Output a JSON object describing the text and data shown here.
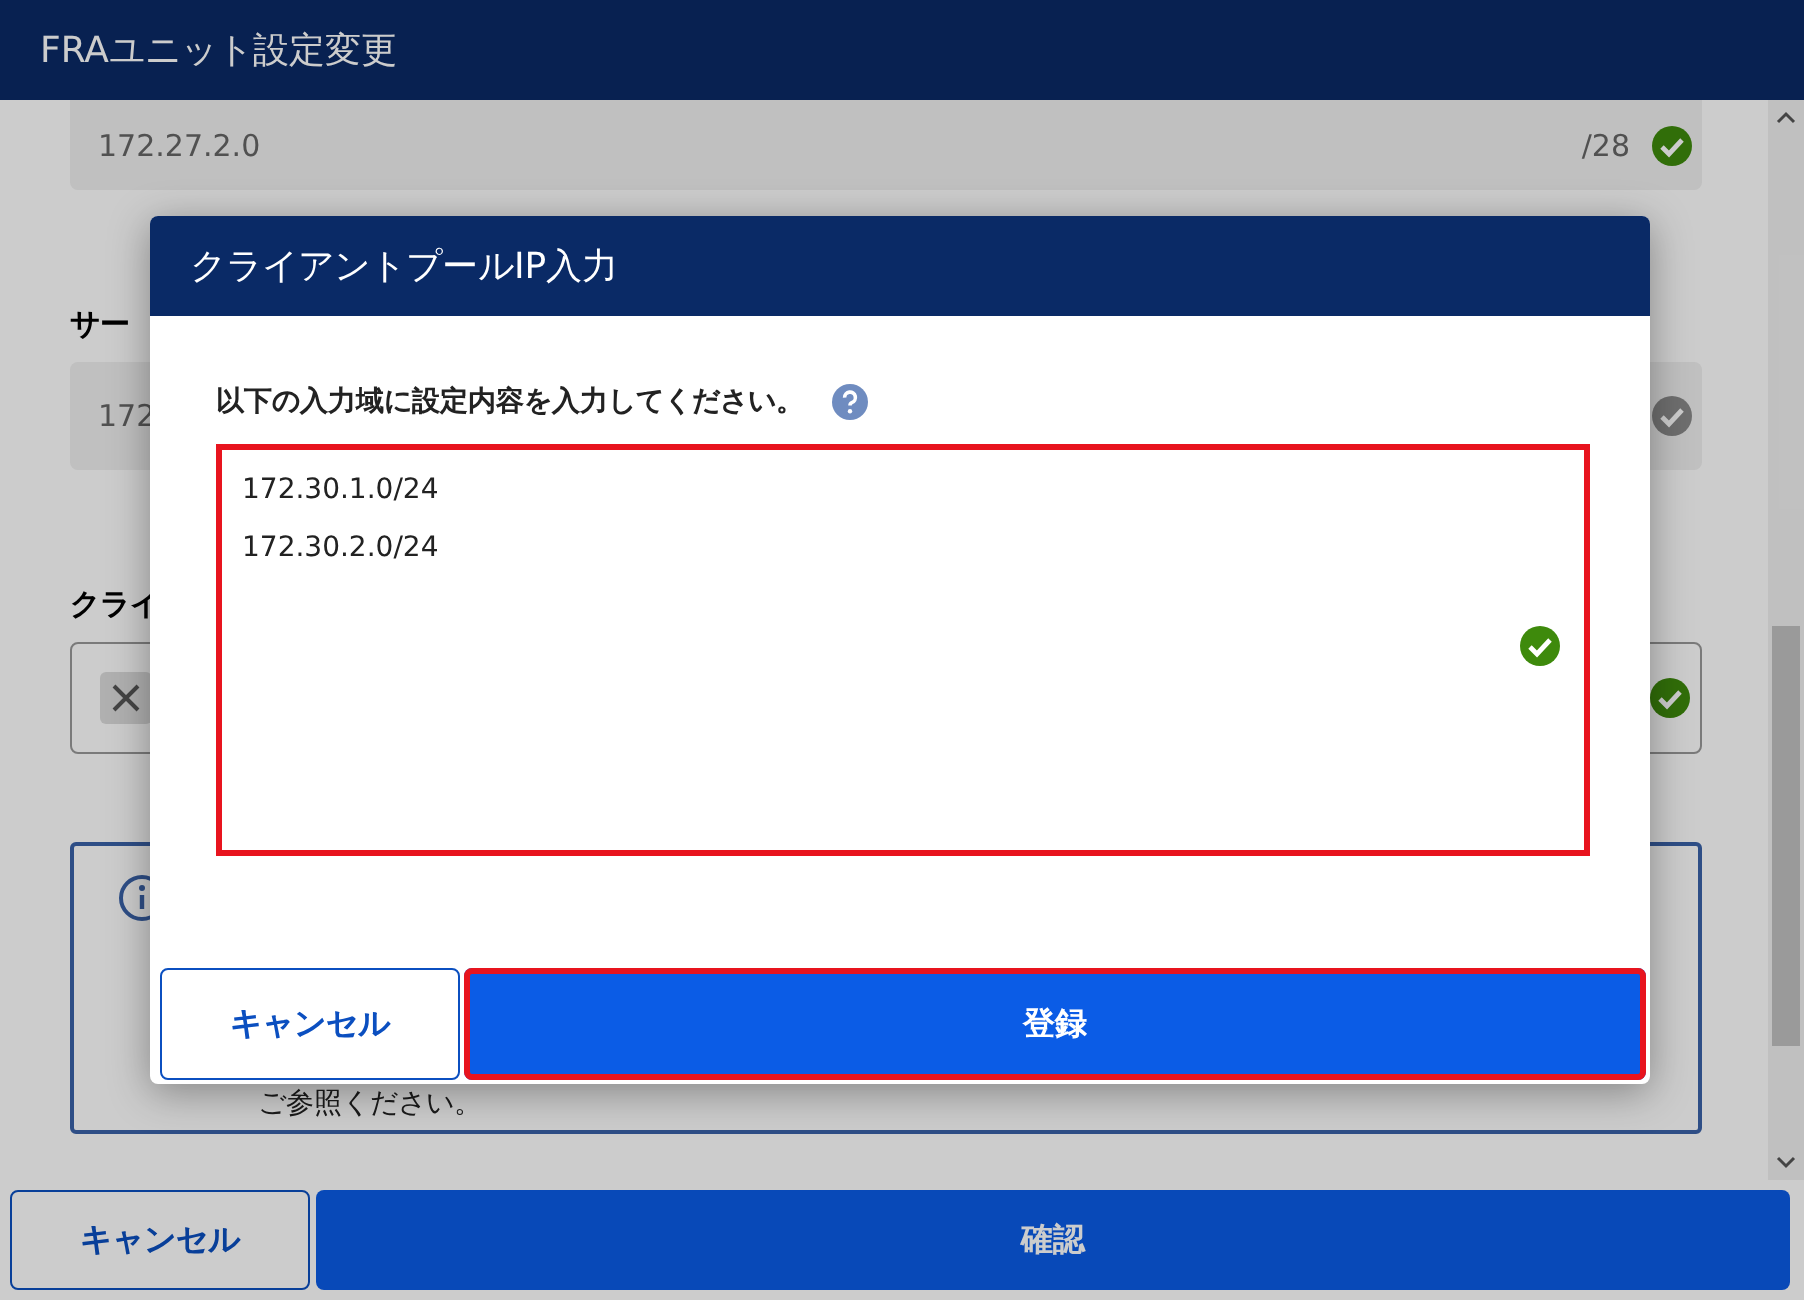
{
  "window": {
    "title": "FRAユニット設定変更"
  },
  "fields": [
    {
      "kind": "prefix",
      "value": "172.27.2.0",
      "suffix": "/28",
      "valid": true
    },
    {
      "kind": "text",
      "label": "サー",
      "value": "172",
      "valid": false
    },
    {
      "kind": "chips",
      "label": "クライ",
      "valid": true
    }
  ],
  "info": {
    "text": "ご参照ください。"
  },
  "buttons": [
    {
      "label": "キャンセル",
      "kind": "secondary"
    },
    {
      "label": "確認",
      "kind": "primary"
    }
  ],
  "dialog": {
    "title": "クライアントプールIP入力",
    "instruction": "以下の入力域に設定内容を入力してください。",
    "entries": [
      "172.30.1.0/24",
      "172.30.2.0/24"
    ],
    "valid": true,
    "highlighted": true,
    "buttons": [
      {
        "label": "キャンセル",
        "kind": "secondary",
        "highlighted": false
      },
      {
        "label": "登録",
        "kind": "primary",
        "highlighted": true
      }
    ]
  }
}
